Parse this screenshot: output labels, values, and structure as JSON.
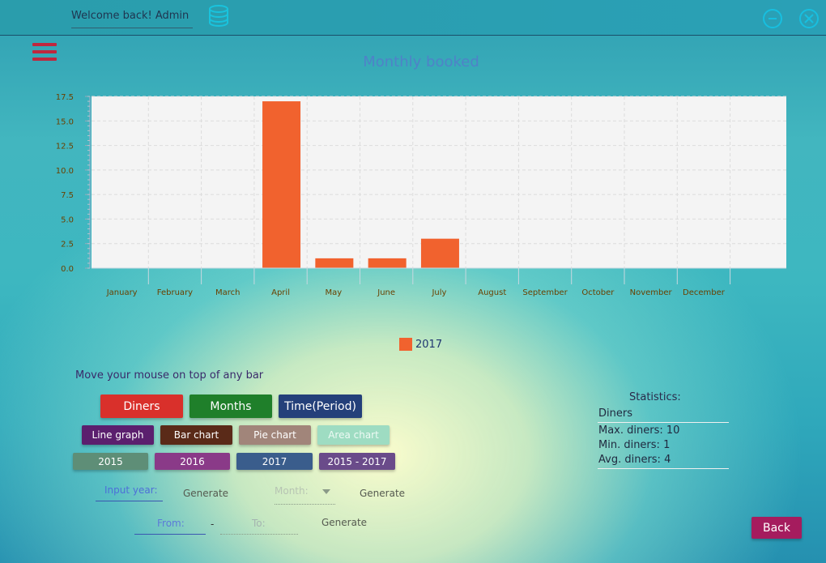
{
  "header": {
    "welcome": "Welcome back! Admin",
    "icons": [
      "database-icon",
      "minimize-icon",
      "close-icon"
    ]
  },
  "menu_icon": "hamburger-menu-icon",
  "chart_data": {
    "type": "bar",
    "title": "Monthly booked",
    "categories": [
      "January",
      "February",
      "March",
      "April",
      "May",
      "June",
      "July",
      "August",
      "September",
      "October",
      "November",
      "December"
    ],
    "series": [
      {
        "name": "2017",
        "values": [
          0,
          0,
          0,
          17,
          1,
          1,
          3,
          0,
          0,
          0,
          0,
          0
        ],
        "color": "#f1622e"
      }
    ],
    "ylim": [
      0,
      17.5
    ],
    "yticks": [
      "17.5",
      "15.0",
      "12.5",
      "10.0",
      "7.5",
      "5.0",
      "2.5",
      "0.0"
    ],
    "grid": true,
    "legend_position": "bottom-center"
  },
  "hint": "Move your mouse on top of any bar",
  "buttons": {
    "diners": "Diners",
    "months": "Months",
    "time_period": "Time(Period)",
    "line_graph": "Line graph",
    "bar_chart": "Bar chart",
    "pie_chart": "Pie chart",
    "area_chart": "Area chart",
    "y2015": "2015",
    "y2016": "2016",
    "y2017": "2017",
    "y2015_2017": "2015 - 2017",
    "back": "Back"
  },
  "inputs": {
    "year_placeholder": "Input year:",
    "month_placeholder": "Month:",
    "from_placeholder": "From:",
    "to_placeholder": "To:",
    "range_separator": "-",
    "generate": "Generate"
  },
  "statistics": {
    "title": "Statistics:",
    "subject": "Diners",
    "max": "Max. diners: 10",
    "min": "Min. diners: 1",
    "avg": "Avg. diners: 4"
  },
  "colors": {
    "diners": "#d9302b",
    "months": "#1f7f2a",
    "time_period": "#24407a",
    "line_graph": "#5b1f6e",
    "bar_chart": "#5a2a18",
    "pie_chart": "#a1857a",
    "area_chart": "#9edcc2",
    "y2015": "#5e8e77",
    "y2016": "#8a3a88",
    "y2017": "#3a5d8c",
    "y2015_2017": "#6a4b8a",
    "back": "#a51c5e"
  }
}
